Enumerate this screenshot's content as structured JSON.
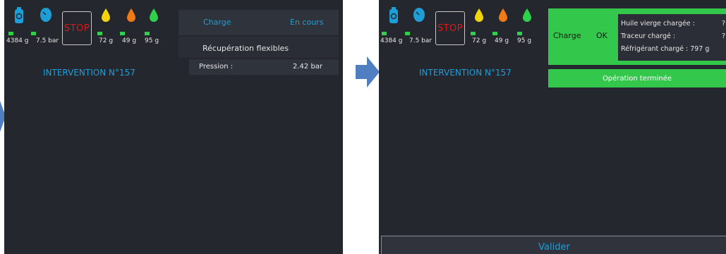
{
  "colors": {
    "screen_bg": "#25272f",
    "accent_cyan": "#1e9ed6",
    "green": "#33c74c",
    "stop_red": "#d41c1c",
    "arrow_blue": "#4f7fc0"
  },
  "status_bar": {
    "icons": [
      "cylinder-icon",
      "pressure-gauge-icon",
      "yellow-drop-icon",
      "orange-drop-icon",
      "green-drop-icon"
    ],
    "refrigerant_weight": "4384 g",
    "pressure": "7.5 bar",
    "stop_label": "STOP",
    "yellow_oil": "72 g",
    "orange_oil": "49 g",
    "green_oil": "95 g"
  },
  "screen1": {
    "intervention": "INTERVENTION N°157",
    "header_left": "Charge",
    "header_right": "En cours",
    "recovery_title": "Récupération flexibles",
    "pressure_label": "Pression :",
    "pressure_value": "2.42 bar"
  },
  "screen2": {
    "intervention": "INTERVENTION N°157",
    "charge_label": "Charge",
    "charge_status": "OK",
    "info_oil": "Huile vierge chargée :",
    "info_oil_value": "?",
    "info_tracer": "Traceur chargé :",
    "info_tracer_value": "?",
    "info_refrigerant": "Réfrigérant chargé : 797 g",
    "operation_done": "Opération terminée",
    "validate_button": "Valider"
  }
}
